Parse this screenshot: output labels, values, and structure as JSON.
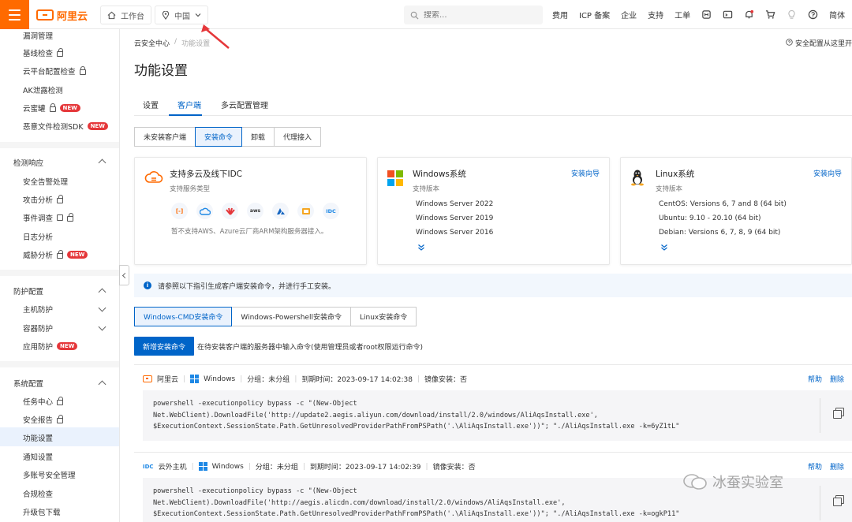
{
  "topbar": {
    "logo_text": "阿里云",
    "workbench_label": "工作台",
    "region_label": "中国",
    "search_placeholder": "搜索...",
    "links": [
      "费用",
      "ICP 备案",
      "企业",
      "支持",
      "工单"
    ],
    "lang_label": "简体",
    "brand_color": "#ff6a00",
    "annotation_arrow_color": "#e5373a"
  },
  "sidebar": {
    "items_top": [
      "漏洞管理",
      "基线检查",
      "云平台配置检查",
      "AK泄露检测",
      "云蜜罐",
      "恶意文件检测SDK"
    ],
    "group_response": "检测响应",
    "items_response": [
      "安全告警处理",
      "攻击分析",
      "事件调查",
      "日志分析",
      "威胁分析"
    ],
    "group_protect": "防护配置",
    "items_protect": [
      "主机防护",
      "容器防护",
      "应用防护"
    ],
    "group_system": "系统配置",
    "items_system": [
      "任务中心",
      "安全报告",
      "功能设置",
      "通知设置",
      "多账号安全管理",
      "合规检查",
      "升级包下载"
    ],
    "new_badge": "NEW"
  },
  "main": {
    "breadcrumb_root": "云安全中心",
    "breadcrumb_sep": "/",
    "breadcrumb_current": "功能设置",
    "help_link": "安全配置从这里开",
    "title": "功能设置",
    "tabs": [
      "设置",
      "客户端",
      "多云配置管理"
    ],
    "client_buttons": [
      "未安装客户端",
      "安装命令",
      "卸载",
      "代理接入"
    ],
    "card_idc": {
      "title": "支持多云及线下IDC",
      "sub": "支持服务类型",
      "vendors": [
        "阿里云",
        "腾讯云",
        "华为云",
        "AWS",
        "Azure",
        "其他",
        "IDC"
      ],
      "note": "暂不支持AWS、Azure云厂商ARM架构服务器接入。"
    },
    "card_windows": {
      "title": "Windows系统",
      "sub": "支持版本",
      "link": "安装向导",
      "versions": [
        "Windows Server 2022",
        "Windows Server 2019",
        "Windows Server 2016"
      ]
    },
    "card_linux": {
      "title": "Linux系统",
      "sub": "支持版本",
      "link": "安装向导",
      "versions": [
        "CentOS: Versions 6, 7 and 8 (64 bit)",
        "Ubuntu: 9.10 - 20.10 (64 bit)",
        "Debian: Versions 6, 7, 8, 9 (64 bit)"
      ]
    },
    "notice": "请参照以下指引生成客户端安装命令，并进行手工安装。",
    "cmd_tabs": [
      "Windows-CMD安装命令",
      "Windows-Powershell安装命令",
      "Linux安装命令"
    ],
    "new_cmd_button": "新增安装命令",
    "new_cmd_hint": "在待安装客户端的服务器中输入命令(使用管理员或者root权限运行命令)",
    "commands": [
      {
        "vendor": "阿里云",
        "os": "Windows",
        "group": "分组：未分组",
        "expire": "到期时间：2023-09-17 14:02:38",
        "image": "镜像安装：否",
        "help": "帮助",
        "delete": "删除",
        "code": "powershell -executionpolicy bypass -c \"(New-Object\nNet.WebClient).DownloadFile('http://update2.aegis.aliyun.com/download/install/2.0/windows/AliAqsInstall.exe',\n$ExecutionContext.SessionState.Path.GetUnresolvedProviderPathFromPSPath('.\\AliAqsInstall.exe'))\"; \"./AliAqsInstall.exe -k=6yZ1tL\""
      },
      {
        "vendor": "云外主机",
        "os": "Windows",
        "group": "分组：未分组",
        "expire": "到期时间：2023-09-17 14:02:39",
        "image": "镜像安装：否",
        "help": "帮助",
        "delete": "删除",
        "code": "powershell -executionpolicy bypass -c \"(New-Object\nNet.WebClient).DownloadFile('http://aegis.alicdn.com/download/install/2.0/windows/AliAqsInstall.exe',\n$ExecutionContext.SessionState.Path.GetUnresolvedProviderPathFromPSPath('.\\AliAqsInstall.exe'))\"; \"./AliAqsInstall.exe -k=ogkP11\""
      }
    ]
  },
  "watermark": "冰蚕实验室"
}
